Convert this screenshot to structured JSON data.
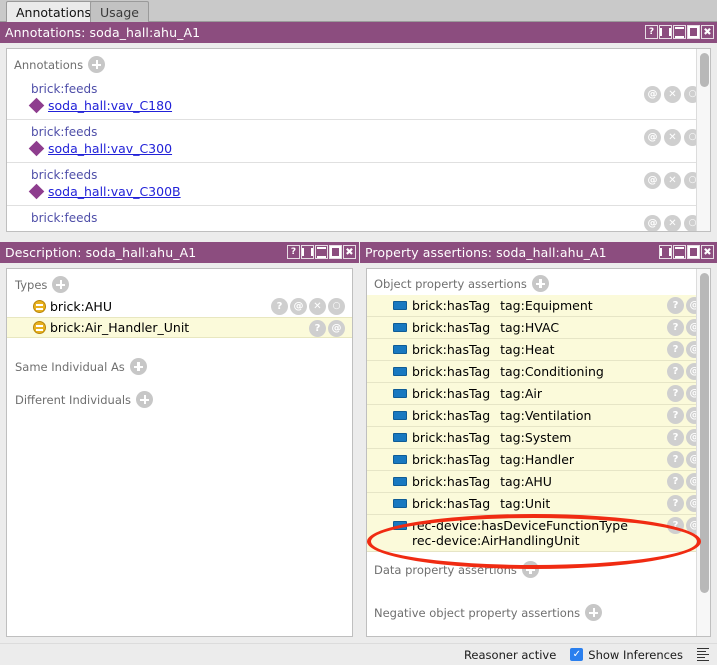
{
  "tabs": [
    {
      "label": "Annotations",
      "selected": true
    },
    {
      "label": "Usage",
      "selected": false
    }
  ],
  "window_buttons": {
    "help": "?",
    "split": "split-pane",
    "minimize": "minimize",
    "maximize": "maximize",
    "close": "✕"
  },
  "annotations_panel": {
    "title": "Annotations: soda_hall:ahu_A1",
    "section_label": "Annotations",
    "rows": [
      {
        "property": "brick:feeds",
        "value": "soda_hall:vav_C180"
      },
      {
        "property": "brick:feeds",
        "value": "soda_hall:vav_C300"
      },
      {
        "property": "brick:feeds",
        "value": "soda_hall:vav_C300B"
      },
      {
        "property": "brick:feeds",
        "value": ""
      }
    ],
    "row_buttons": [
      "@",
      "✕",
      "○"
    ]
  },
  "description_panel": {
    "title": "Description: soda_hall:ahu_A1",
    "types_label": "Types",
    "types": [
      {
        "label": "brick:AHU",
        "highlighted": false,
        "buttons": [
          "?",
          "@",
          "✕",
          "○"
        ]
      },
      {
        "label": "brick:Air_Handler_Unit",
        "highlighted": true,
        "buttons": [
          "?",
          "@"
        ]
      }
    ],
    "same_individual_label": "Same Individual As",
    "different_individuals_label": "Different Individuals"
  },
  "property_assertions_panel": {
    "title": "Property assertions: soda_hall:ahu_A1",
    "object_section_label": "Object property assertions",
    "assertions": [
      {
        "property": "brick:hasTag",
        "value": "tag:Equipment",
        "wrapped": false
      },
      {
        "property": "brick:hasTag",
        "value": "tag:HVAC",
        "wrapped": false
      },
      {
        "property": "brick:hasTag",
        "value": "tag:Heat",
        "wrapped": false
      },
      {
        "property": "brick:hasTag",
        "value": "tag:Conditioning",
        "wrapped": false
      },
      {
        "property": "brick:hasTag",
        "value": "tag:Air",
        "wrapped": false
      },
      {
        "property": "brick:hasTag",
        "value": "tag:Ventilation",
        "wrapped": false
      },
      {
        "property": "brick:hasTag",
        "value": "tag:System",
        "wrapped": false
      },
      {
        "property": "brick:hasTag",
        "value": "tag:Handler",
        "wrapped": false
      },
      {
        "property": "brick:hasTag",
        "value": "tag:AHU",
        "wrapped": false
      },
      {
        "property": "brick:hasTag",
        "value": "tag:Unit",
        "wrapped": false
      },
      {
        "property": "rec-device:hasDeviceFunctionType",
        "value": "rec-device:AirHandlingUnit",
        "wrapped": true
      }
    ],
    "row_buttons": [
      "?",
      "@"
    ],
    "data_section_label": "Data property assertions",
    "negative_section_label": "Negative object property assertions"
  },
  "highlight": {
    "shape": "red-ellipse",
    "target": "rec-device:hasDeviceFunctionType"
  },
  "status_bar": {
    "reasoner_text": "Reasoner active",
    "show_inferences_label": "Show Inferences",
    "show_inferences_checked": true,
    "menu_icon": "list-icon"
  },
  "colors": {
    "title_bar": "#8c4d7f",
    "row_highlight": "#fbfada",
    "link": "#2222d8",
    "property": "#4e4ea8",
    "object_icon": "#1878c0",
    "class_icon": "#e8b11e",
    "annotation_ellipse": "#f02b12",
    "checkbox": "#2a7fee"
  }
}
